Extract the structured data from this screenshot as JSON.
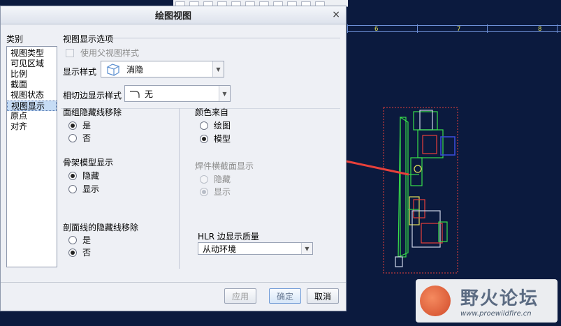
{
  "dialog": {
    "title": "绘图视图",
    "close_glyph": "×"
  },
  "categories": {
    "label": "类别",
    "items": [
      "视图类型",
      "可见区域",
      "比例",
      "截面",
      "视图状态",
      "视图显示",
      "原点",
      "对齐"
    ],
    "selected_index": 5
  },
  "view_display": {
    "group_title": "视图显示选项",
    "use_parent_label": "使用父视图样式",
    "display_style_label": "显示样式",
    "display_style_value": "消隐",
    "tangent_label": "相切边显示样式",
    "tangent_value": "无",
    "face_hidden": {
      "title": "面组隐藏线移除",
      "options": [
        "是",
        "否"
      ],
      "selected": 0
    },
    "color_from": {
      "title": "颜色来自",
      "options": [
        "绘图",
        "模型"
      ],
      "selected": 1
    },
    "skeleton": {
      "title": "骨架模型显示",
      "options": [
        "隐藏",
        "显示"
      ],
      "selected": 0
    },
    "weld": {
      "title": "焊件横截面显示",
      "options": [
        "隐藏",
        "显示"
      ],
      "selected": 1
    },
    "hatch_hidden": {
      "title": "剖面线的隐藏线移除",
      "options": [
        "是",
        "否"
      ],
      "selected": 1
    },
    "hlr_label": "HLR 边显示质量",
    "hlr_value": "从动环境"
  },
  "buttons": {
    "apply": "应用",
    "ok": "确定",
    "cancel": "取消"
  },
  "ruler": {
    "numbers": [
      "6",
      "7",
      "8"
    ]
  },
  "watermark": {
    "title": "野火论坛",
    "url": "www.proewildfire.cn"
  },
  "colors": {
    "cad_background": "#0b1a3e",
    "model_green": "#39e04a",
    "annotation_red": "#e8403a"
  }
}
